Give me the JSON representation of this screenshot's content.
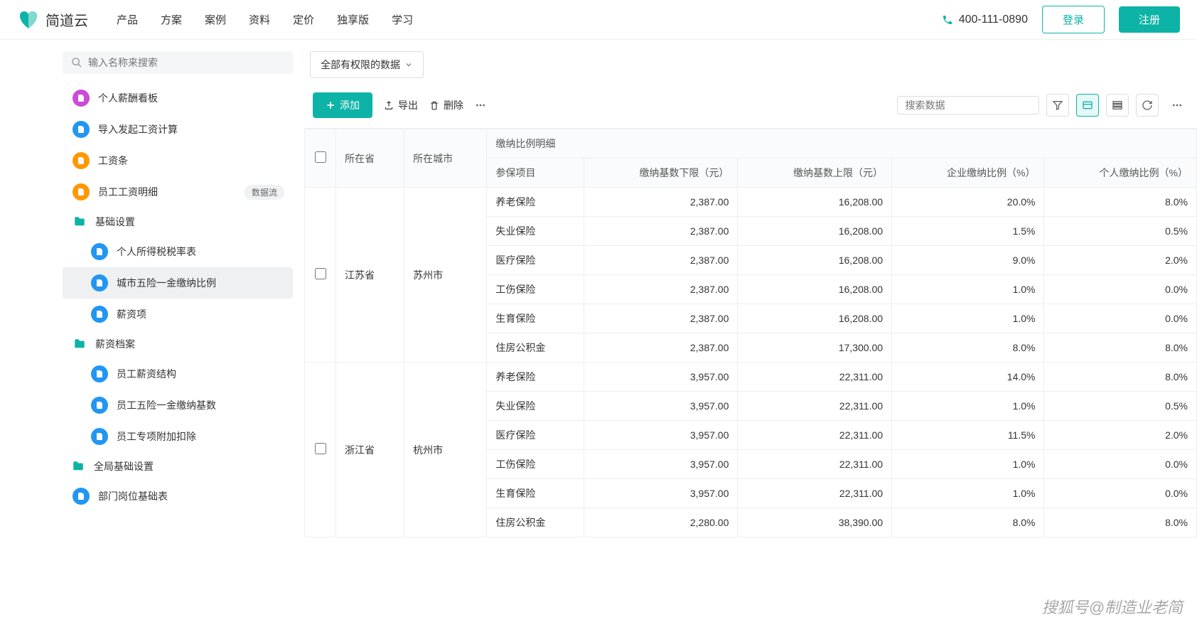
{
  "header": {
    "brand": "简道云",
    "nav": [
      "产品",
      "方案",
      "案例",
      "资料",
      "定价",
      "独享版",
      "学习"
    ],
    "phone": "400-111-0890",
    "login": "登录",
    "register": "注册"
  },
  "sidebar": {
    "search_placeholder": "输入名称来搜索",
    "items": [
      {
        "label": "个人薪酬看板",
        "icon": "purple",
        "level": 1
      },
      {
        "label": "导入发起工资计算",
        "icon": "blue",
        "level": 1
      },
      {
        "label": "工资条",
        "icon": "orange",
        "level": 1
      },
      {
        "label": "员工工资明细",
        "icon": "orange",
        "level": 1,
        "badge": "数据流"
      },
      {
        "label": "基础设置",
        "icon": "folder",
        "level": 1
      },
      {
        "label": "个人所得税税率表",
        "icon": "blue",
        "level": 2
      },
      {
        "label": "城市五险一金缴纳比例",
        "icon": "blue",
        "level": 2,
        "active": true
      },
      {
        "label": "薪资项",
        "icon": "blue",
        "level": 2
      },
      {
        "label": "薪资档案",
        "icon": "folder",
        "level": 1
      },
      {
        "label": "员工薪资结构",
        "icon": "blue",
        "level": 2
      },
      {
        "label": "员工五险一金缴纳基数",
        "icon": "blue",
        "level": 2
      },
      {
        "label": "员工专项附加扣除",
        "icon": "blue",
        "level": 2
      },
      {
        "label": "全局基础设置",
        "icon": "folder",
        "level": 0
      },
      {
        "label": "部门岗位基础表",
        "icon": "blue",
        "level": 1
      }
    ]
  },
  "content": {
    "dropdown": "全部有权限的数据",
    "toolbar": {
      "add": "添加",
      "export": "导出",
      "delete": "删除",
      "search_placeholder": "搜索数据"
    },
    "table": {
      "headers": {
        "province": "所在省",
        "city": "所在城市",
        "detail_group": "缴纳比例明细",
        "item": "参保项目",
        "base_low": "缴纳基数下限（元）",
        "base_high": "缴纳基数上限（元）",
        "corp_rate": "企业缴纳比例（%）",
        "pers_rate": "个人缴纳比例（%）"
      },
      "rows": [
        {
          "province": "江苏省",
          "city": "苏州市",
          "details": [
            {
              "item": "养老保险",
              "low": "2,387.00",
              "high": "16,208.00",
              "corp": "20.0%",
              "pers": "8.0%"
            },
            {
              "item": "失业保险",
              "low": "2,387.00",
              "high": "16,208.00",
              "corp": "1.5%",
              "pers": "0.5%"
            },
            {
              "item": "医疗保险",
              "low": "2,387.00",
              "high": "16,208.00",
              "corp": "9.0%",
              "pers": "2.0%"
            },
            {
              "item": "工伤保险",
              "low": "2,387.00",
              "high": "16,208.00",
              "corp": "1.0%",
              "pers": "0.0%"
            },
            {
              "item": "生育保险",
              "low": "2,387.00",
              "high": "16,208.00",
              "corp": "1.0%",
              "pers": "0.0%"
            },
            {
              "item": "住房公积金",
              "low": "2,387.00",
              "high": "17,300.00",
              "corp": "8.0%",
              "pers": "8.0%"
            }
          ]
        },
        {
          "province": "浙江省",
          "city": "杭州市",
          "details": [
            {
              "item": "养老保险",
              "low": "3,957.00",
              "high": "22,311.00",
              "corp": "14.0%",
              "pers": "8.0%"
            },
            {
              "item": "失业保险",
              "low": "3,957.00",
              "high": "22,311.00",
              "corp": "1.0%",
              "pers": "0.5%"
            },
            {
              "item": "医疗保险",
              "low": "3,957.00",
              "high": "22,311.00",
              "corp": "11.5%",
              "pers": "2.0%"
            },
            {
              "item": "工伤保险",
              "low": "3,957.00",
              "high": "22,311.00",
              "corp": "1.0%",
              "pers": "0.0%"
            },
            {
              "item": "生育保险",
              "low": "3,957.00",
              "high": "22,311.00",
              "corp": "1.0%",
              "pers": "0.0%"
            },
            {
              "item": "住房公积金",
              "low": "2,280.00",
              "high": "38,390.00",
              "corp": "8.0%",
              "pers": "8.0%"
            }
          ]
        }
      ]
    }
  },
  "watermark": "搜狐号@制造业老简"
}
